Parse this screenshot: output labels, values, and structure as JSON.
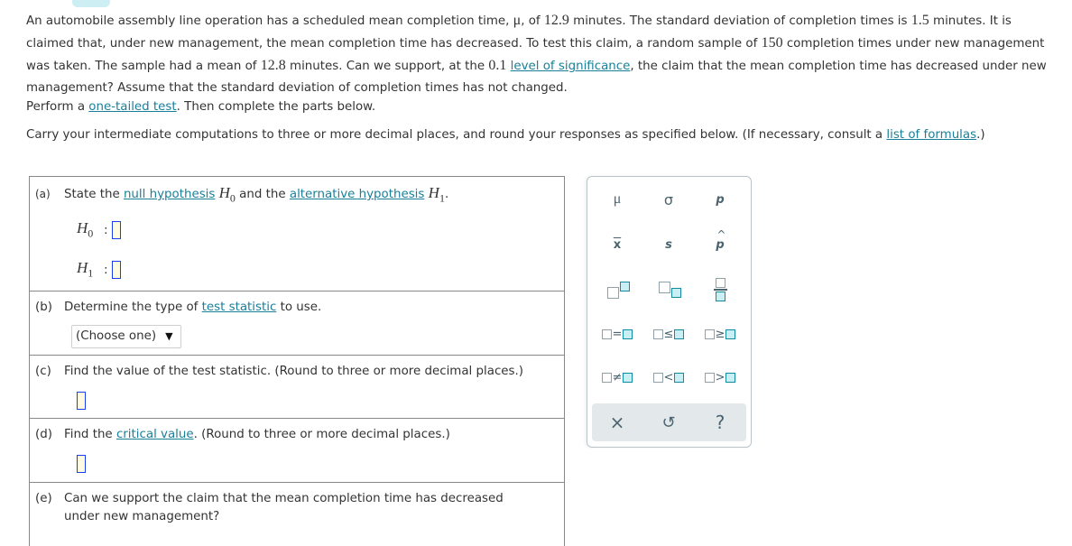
{
  "problem": {
    "text_1": "An automobile assembly line operation has a scheduled mean completion time, ",
    "mu_symbol": "μ",
    "text_2": ", of ",
    "mean": "12.9",
    "text_3": " minutes. The standard deviation of completion times is ",
    "std_dev": "1.5",
    "text_4": " minutes. It is claimed that, under new management, the mean completion time has decreased. To test this claim, a random sample of ",
    "sample_size": "150",
    "text_5": " completion times under new management was taken. The sample had a mean of ",
    "sample_mean": "12.8",
    "text_6": " minutes. Can we support, at the ",
    "alpha": "0.1",
    "text_7": " ",
    "link_significance": "level of significance",
    "text_8": ", the claim that the mean completion time has decreased under new management? Assume that the standard deviation of completion times has not changed."
  },
  "perform": {
    "prefix": "Perform a ",
    "link": "one-tailed test",
    "suffix": ". Then complete the parts below."
  },
  "carry": {
    "prefix": "Carry your intermediate computations to three or more decimal places, and round your responses as specified below. (If necessary, consult a ",
    "link": "list of formulas",
    "suffix": ".)"
  },
  "parts": {
    "a": {
      "letter": "(a)",
      "text_1": "State the ",
      "link_null": "null hypothesis",
      "h0": "H",
      "h0_sub": "0",
      "text_2": " and the ",
      "link_alt": "alternative hypothesis",
      "h1": "H",
      "h1_sub": "1",
      "text_3": ".",
      "row_h0_label": "H",
      "row_h0_sub": "0",
      "row_h1_label": "H",
      "row_h1_sub": "1",
      "colon": ":",
      "h0_value": "",
      "h1_value": ""
    },
    "b": {
      "letter": "(b)",
      "text_1": "Determine the type of ",
      "link": "test statistic",
      "text_2": " to use.",
      "select_value": "(Choose one)",
      "select_arrow": "▼"
    },
    "c": {
      "letter": "(c)",
      "text": "Find the value of the test statistic. (Round to three or more decimal places.)",
      "value": ""
    },
    "d": {
      "letter": "(d)",
      "text_1": "Find the ",
      "link": "critical value",
      "text_2": ". (Round to three or more decimal places.)",
      "value": ""
    },
    "e": {
      "letter": "(e)",
      "text_line1": "Can we support the claim that the mean completion time has decreased",
      "text_line2": "under new management?"
    }
  },
  "palette": {
    "symbols": [
      "μ",
      "σ",
      "p",
      "x",
      "s",
      "p"
    ],
    "relations": [
      "=",
      "≤",
      "≥",
      "≠",
      "<",
      ">"
    ],
    "actions": {
      "clear": "×",
      "undo": "↺",
      "help": "?"
    }
  }
}
